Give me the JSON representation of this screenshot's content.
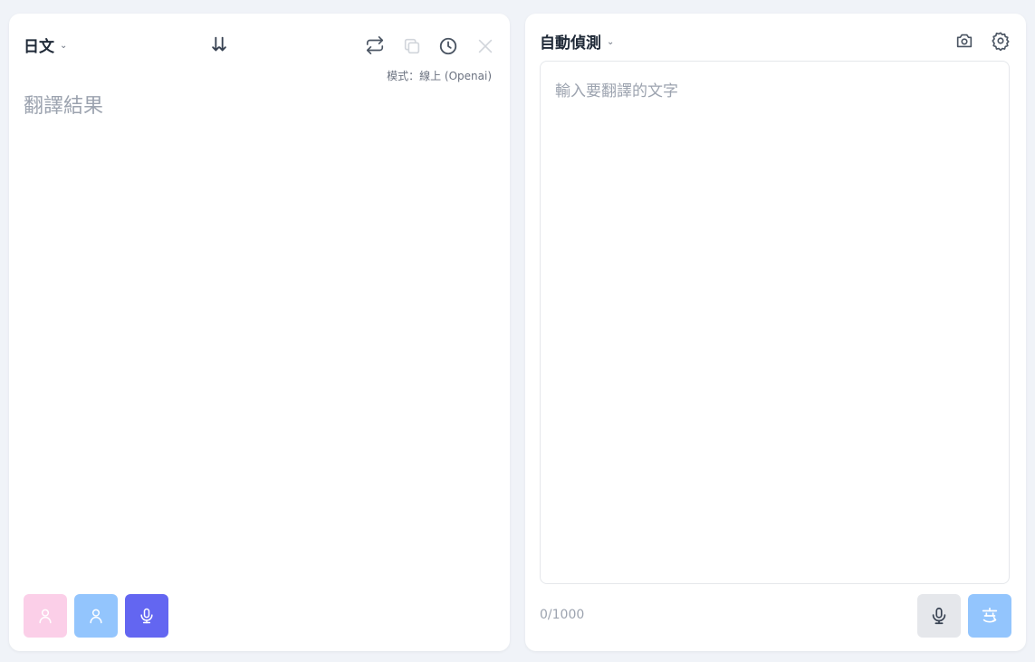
{
  "target_panel": {
    "language": "日文",
    "mode_text": "模式：線上 (Openai)",
    "result_placeholder": "翻譯結果",
    "icons": {
      "swap": "arrow-down-up-icon",
      "switch": "repeat-icon",
      "copy": "copy-icon",
      "history": "clock-icon",
      "clear": "close-icon",
      "voice_female": "person-icon",
      "voice_male": "person-icon",
      "mic": "microphone-icon"
    },
    "colors": {
      "voice_female": "#fbcfe8",
      "voice_male": "#93c5fd",
      "mic": "#6366f1"
    }
  },
  "source_panel": {
    "language": "自動偵測",
    "input_placeholder": "輸入要翻譯的文字",
    "input_value": "",
    "char_count": "0/1000",
    "icons": {
      "camera": "camera-icon",
      "settings": "gear-icon",
      "mic": "microphone-icon",
      "translate": "translate-icon"
    },
    "colors": {
      "translate": "#93c5fd"
    }
  }
}
